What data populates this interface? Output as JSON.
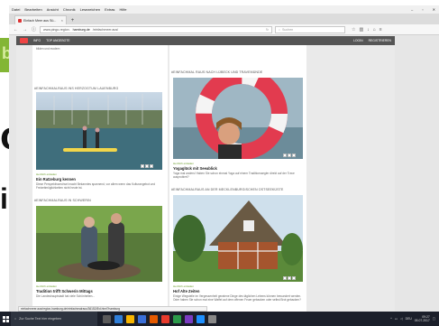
{
  "browser": {
    "menu": [
      "Datei",
      "Bearbeiten",
      "Ansicht",
      "Chronik",
      "Lesezeichen",
      "Extras",
      "Hilfe"
    ],
    "tab_title": "Einfach Meer aus Sü...",
    "url_prefix": "www.pingo-region.",
    "url_host": "hamburg.de",
    "url_path": "/einfachmeer.aus/",
    "search_placeholder": "Suchen",
    "window_controls": [
      "–",
      "▫",
      "✕"
    ]
  },
  "site": {
    "nav_left": [
      "INFO",
      "TOP ANGEBOTE"
    ],
    "nav_right": [
      "LOGIN",
      "REGISTRIEREN"
    ]
  },
  "content": {
    "left_top_snippet": "bilden und modern",
    "right_section": "#EINFACHMAL RAUS NACH LÜBECK UND TRAVEMÜNDE",
    "right_section2": "#EINFACHMALRAUS AN DER MECKLENBURGISCHEN OSTSEEKÜSTE",
    "left_section": "#EINFACHMALRAUS INS HERZOGTUM LAUENBURG",
    "left_section2": "#EINFACHMALRAUS IN SCHWERIN",
    "card1": {
      "meta": "Herzlich einladen",
      "title": "Yogaglück mit Seeablick",
      "text": "Yoga mal anders! Haben Sie schon einmal Yoga auf einem Traditionssegler direkt auf der Trave ausprobiert?"
    },
    "card2": {
      "meta": "Herzlich einladen",
      "title": "Ein Ratzeburg kennen",
      "text": "Diese Perspektivwechsel macht Bekanntes spannend, vor allem wenn das Kulturangebot und Freizeitmöglichkeiten nicht heute ist."
    },
    "card3": {
      "meta": "Herzlich einladen",
      "title": "Hof Alte Zeiten",
      "text": "Einige Wegstelle im Vergessenheit geratene Dinge des täglichen Lebens können bewundert werden. Oder haben Sie schon mal eine Waffel auf dem offenen Feuer gebacken oder selbst Brot gebacken?"
    },
    "card4": {
      "meta": "Herzlich einladen",
      "title": "Tradition trifft Schwerin Mittags",
      "text": "Die Landeshauptstadt hat viele Schönheiten..."
    }
  },
  "status_url": "einfachmeer.aus/region-hamburg.de/einfachmalraus/36152/8/d.html?hamburg",
  "taskbar": {
    "search_text": "Zur Suche Text hier eingeben",
    "time": "09:27",
    "date": "05.07.2017",
    "language": "DEU",
    "app_colors": [
      "#5a5a5a",
      "#2f7ed8",
      "#f7b500",
      "#3a6fd8",
      "#e55a00",
      "#e83b2d",
      "#2b9a4a",
      "#7a3cc2",
      "#1e90ff",
      "#888"
    ]
  },
  "presentation": {
    "tile_letter": "b",
    "big_letters": [
      "o",
      "ic"
    ]
  }
}
